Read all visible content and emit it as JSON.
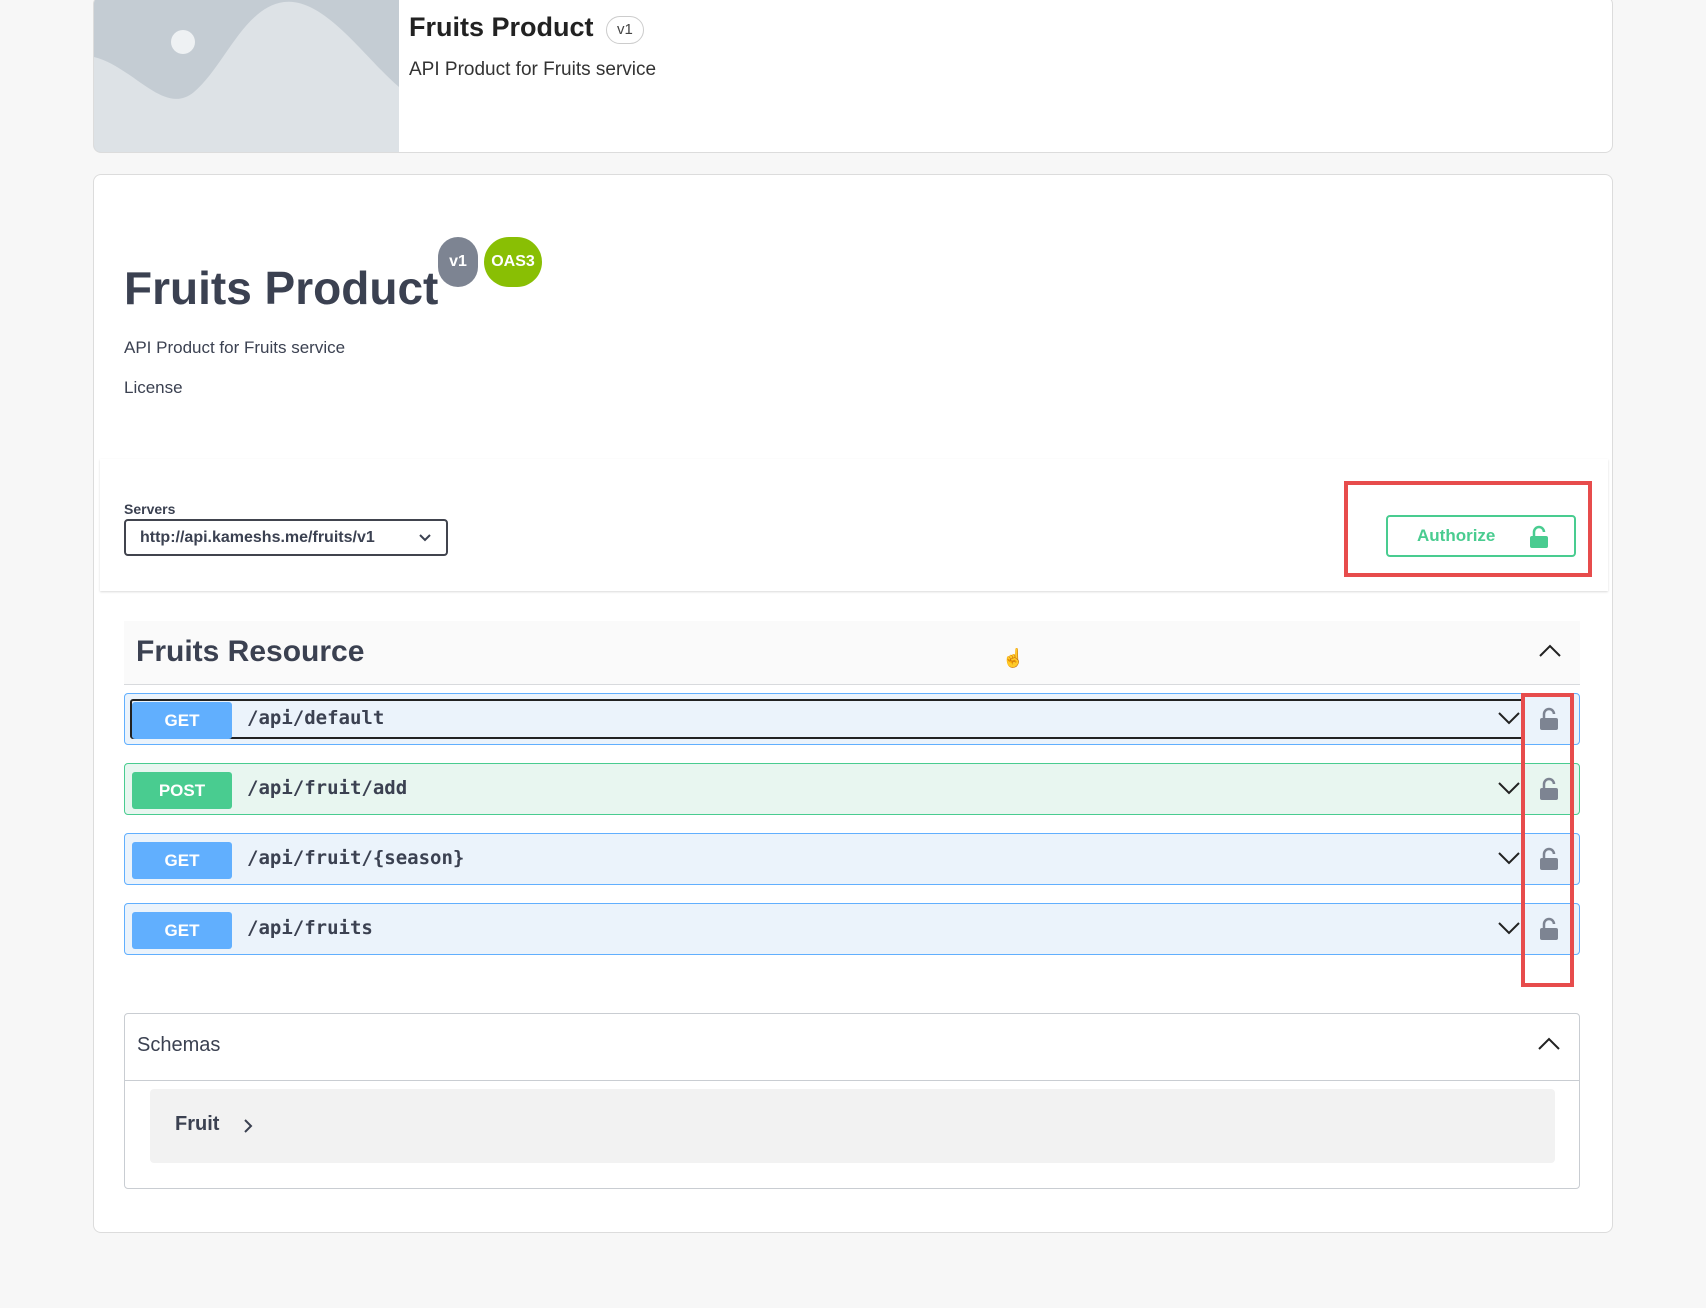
{
  "product_card": {
    "name": "Fruits Product",
    "version": "v1",
    "description": "API Product for Fruits service"
  },
  "info": {
    "title": "Fruits Product",
    "version_badge": "v1",
    "spec_badge": "OAS3",
    "description": "API Product for Fruits service",
    "license_label": "License"
  },
  "servers": {
    "label": "Servers",
    "selected": "http://api.kameshs.me/fruits/v1"
  },
  "authorize": {
    "label": "Authorize"
  },
  "tag": {
    "title": "Fruits Resource",
    "operations": [
      {
        "method": "GET",
        "path": "/api/default"
      },
      {
        "method": "POST",
        "path": "/api/fruit/add"
      },
      {
        "method": "GET",
        "path": "/api/fruit/{season}"
      },
      {
        "method": "GET",
        "path": "/api/fruits"
      }
    ]
  },
  "schemas": {
    "title": "Schemas",
    "models": [
      {
        "name": "Fruit"
      }
    ]
  },
  "colors": {
    "get": "#61affe",
    "post": "#49cc90",
    "oas_badge": "#89bf04",
    "highlight": "#e74c4c"
  },
  "icons": [
    "image-placeholder-icon",
    "chevron-down-icon",
    "lock-icon",
    "chevron-up-icon",
    "chevron-right-icon",
    "hand-cursor-icon"
  ]
}
